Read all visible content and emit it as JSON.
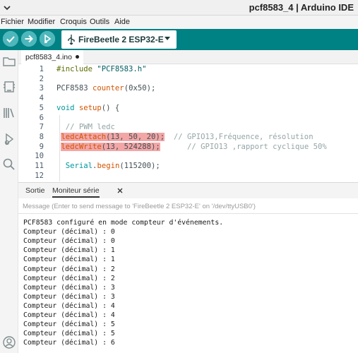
{
  "window": {
    "title": "pcf8583_4 | Arduino IDE"
  },
  "menu": [
    "Fichier",
    "Modifier",
    "Croquis",
    "Outils",
    "Aide"
  ],
  "toolbar": {
    "board": "FireBeetle 2 ESP32-E"
  },
  "editor": {
    "file_tab": "pcf8583_4.ino",
    "lines": [
      {
        "n": "1",
        "segments": [
          {
            "t": "#include ",
            "c": "pp"
          },
          {
            "t": "\"PCF8583.h\"",
            "c": "str"
          }
        ]
      },
      {
        "n": "2",
        "segments": []
      },
      {
        "n": "3",
        "segments": [
          {
            "t": "PCF8583 ",
            "c": "plain"
          },
          {
            "t": "counter",
            "c": "fn"
          },
          {
            "t": "(0x50);",
            "c": "plain"
          }
        ]
      },
      {
        "n": "4",
        "segments": []
      },
      {
        "n": "5",
        "segments": [
          {
            "t": "void ",
            "c": "kw"
          },
          {
            "t": "setup",
            "c": "fn"
          },
          {
            "t": "() {",
            "c": "plain"
          }
        ]
      },
      {
        "n": "6",
        "segments": []
      },
      {
        "n": "7",
        "segments": [
          {
            "t": "  // PWM ledc",
            "c": "cm"
          }
        ]
      },
      {
        "n": "8",
        "segments": [
          {
            "t": " ",
            "c": "plain"
          },
          {
            "t": "ledcAttach",
            "c": "fn hl"
          },
          {
            "t": "(13, 50, 20);",
            "c": "plain hl"
          },
          {
            "t": "  // GPIO13,Fréquence, résolution",
            "c": "cm"
          }
        ]
      },
      {
        "n": "9",
        "segments": [
          {
            "t": " ",
            "c": "plain"
          },
          {
            "t": "ledcWrite",
            "c": "fn hl"
          },
          {
            "t": "(13, 524288);",
            "c": "plain hl"
          },
          {
            "t": "      // GPIO13 ,rapport cyclique 50%",
            "c": "cm"
          }
        ]
      },
      {
        "n": "10",
        "segments": []
      },
      {
        "n": "11",
        "segments": [
          {
            "t": "  ",
            "c": "plain"
          },
          {
            "t": "Serial",
            "c": "kw"
          },
          {
            "t": ".",
            "c": "plain"
          },
          {
            "t": "begin",
            "c": "fn"
          },
          {
            "t": "(115200);",
            "c": "plain"
          }
        ]
      },
      {
        "n": "12",
        "segments": []
      }
    ]
  },
  "panel": {
    "tab_output": "Sortie",
    "tab_serial": "Moniteur série",
    "message_placeholder": "Message (Enter to send message to 'FireBeetle 2 ESP32-E' on '/dev/ttyUSB0')",
    "serial_lines": [
      "PCF8583 configuré en mode compteur d'événements.",
      "Compteur (décimal) : 0",
      "Compteur (décimal) : 0",
      "Compteur (décimal) : 1",
      "Compteur (décimal) : 1",
      "Compteur (décimal) : 2",
      "Compteur (décimal) : 2",
      "Compteur (décimal) : 3",
      "Compteur (décimal) : 3",
      "Compteur (décimal) : 4",
      "Compteur (décimal) : 4",
      "Compteur (décimal) : 5",
      "Compteur (décimal) : 5",
      "Compteur (décimal) : 6"
    ]
  },
  "icons": {
    "titlebar": "chevron-down-icon",
    "toolbar": [
      "verify-icon",
      "upload-icon",
      "debug-icon",
      "usb-icon",
      "caret-down-icon"
    ],
    "sidebar": [
      "folder-icon",
      "board-manager-icon",
      "library-icon",
      "debug-icon",
      "search-icon",
      "account-icon"
    ]
  },
  "colors": {
    "toolbar_bg": "#008184",
    "highlight": "#f3a6a6"
  }
}
